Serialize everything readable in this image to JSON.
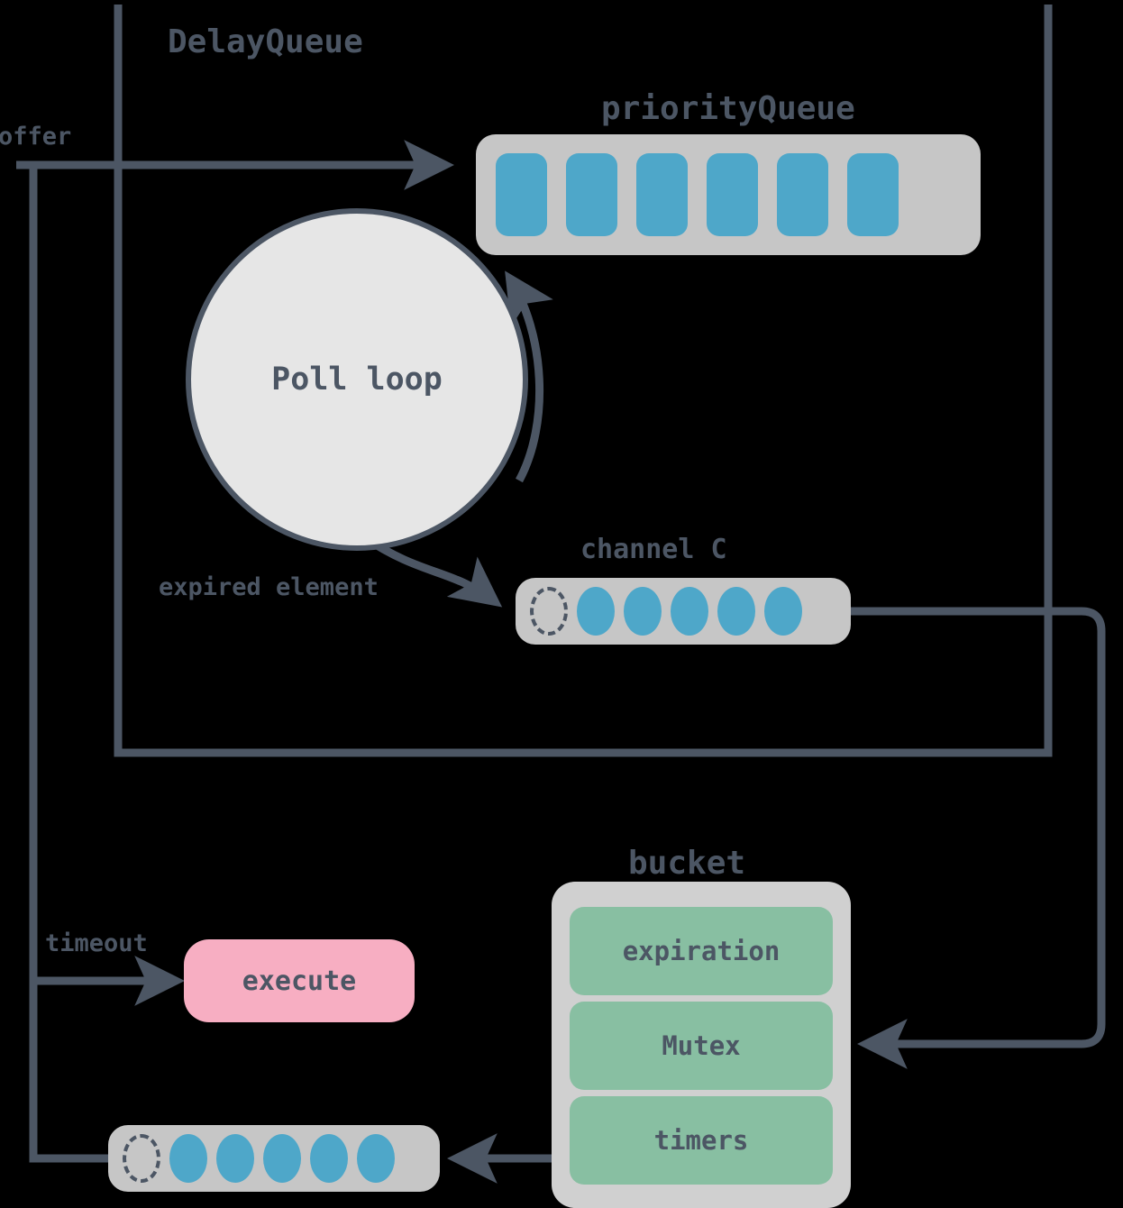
{
  "diagram": {
    "title": "DelayQueue",
    "background_color": "#000000",
    "line_color": "#4c5664",
    "accent_blue": "#4ea7c9",
    "accent_green": "#88bfa2",
    "accent_pink": "#f7aec2",
    "container_grey": "#c6c6c6"
  },
  "labels": {
    "delay_queue": "DelayQueue",
    "priority_queue": "priorityQueue",
    "poll_loop": "Poll loop",
    "channel_c": "channel C",
    "bucket": "bucket",
    "offer": "offer",
    "expired_element": "expired element",
    "timeout": "timeout",
    "execute": "execute"
  },
  "priority_queue": {
    "label": "priorityQueue",
    "cell_count": 6,
    "cells": [
      {
        "state": "filled"
      },
      {
        "state": "filled"
      },
      {
        "state": "filled"
      },
      {
        "state": "filled"
      },
      {
        "state": "filled"
      },
      {
        "state": "filled"
      }
    ]
  },
  "channel_c": {
    "label": "channel C",
    "cell_count": 6,
    "cells": [
      {
        "state": "empty"
      },
      {
        "state": "filled"
      },
      {
        "state": "filled"
      },
      {
        "state": "filled"
      },
      {
        "state": "filled"
      },
      {
        "state": "filled"
      }
    ]
  },
  "bottom_queue": {
    "cell_count": 6,
    "cells": [
      {
        "state": "empty"
      },
      {
        "state": "filled"
      },
      {
        "state": "filled"
      },
      {
        "state": "filled"
      },
      {
        "state": "filled"
      },
      {
        "state": "filled"
      }
    ]
  },
  "bucket": {
    "label": "bucket",
    "fields": [
      {
        "name": "expiration"
      },
      {
        "name": "Mutex"
      },
      {
        "name": "timers"
      }
    ]
  },
  "edges": [
    {
      "name": "offer-edge",
      "label": "offer",
      "from": "external",
      "to": "priorityQueue"
    },
    {
      "name": "poll-loop-edge",
      "label": "",
      "from": "Poll loop",
      "to": "priorityQueue"
    },
    {
      "name": "expired-element-edge",
      "label": "expired element",
      "from": "Poll loop",
      "to": "channel C"
    },
    {
      "name": "channel-to-bucket-edge",
      "label": "",
      "from": "channel C",
      "to": "bucket.Mutex"
    },
    {
      "name": "timers-to-queue-edge",
      "label": "",
      "from": "bucket.timers",
      "to": "bottom queue"
    },
    {
      "name": "timeout-edge",
      "label": "timeout",
      "from": "bottom queue",
      "to": "execute"
    }
  ]
}
